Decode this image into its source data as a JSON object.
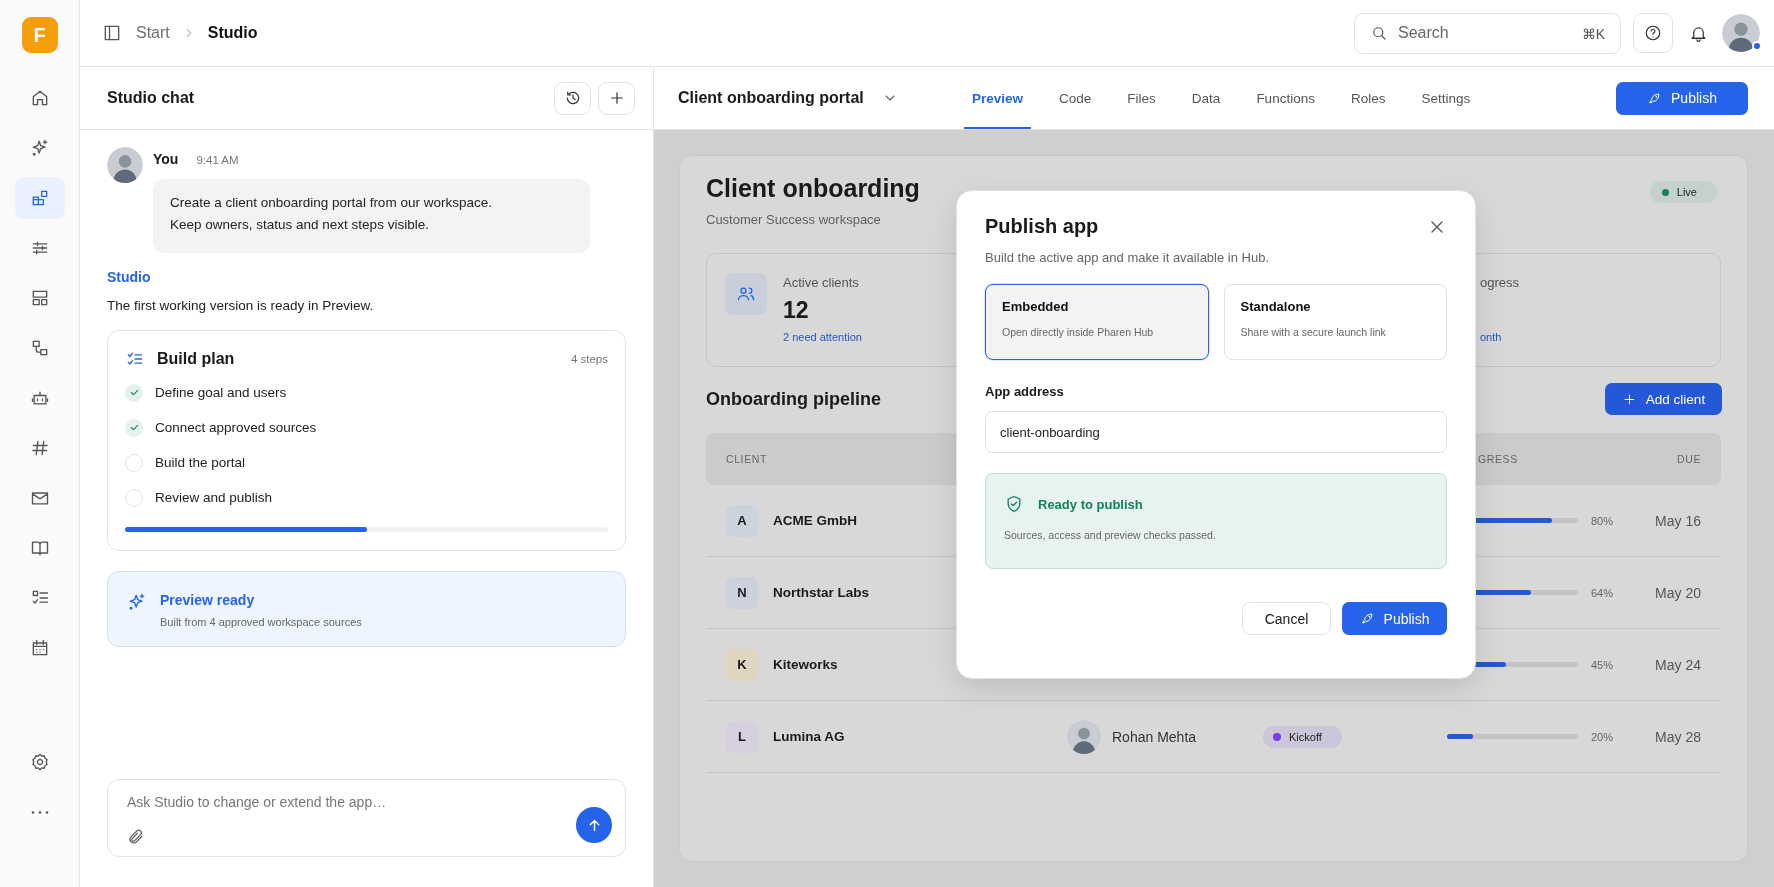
{
  "rail": {
    "logo": "F",
    "items": [
      {
        "selected": false
      },
      {
        "selected": false
      },
      {
        "selected": true
      },
      {
        "selected": false
      },
      {
        "selected": false
      },
      {
        "selected": false
      },
      {
        "selected": false
      },
      {
        "selected": false
      },
      {
        "selected": false
      },
      {
        "selected": false
      },
      {
        "selected": false
      },
      {
        "selected": false
      }
    ]
  },
  "topbar": {
    "breadcrumb": [
      {
        "label": "Start",
        "current": false
      },
      {
        "label": "Studio",
        "current": true
      }
    ],
    "search": {
      "placeholder": "Search",
      "shortcut": "⌘K"
    },
    "user": {
      "online": true
    }
  },
  "chat": {
    "title": "Studio chat",
    "user_message": {
      "author": "You",
      "time": "9:41 AM",
      "lines": [
        "Create a client onboarding portal from our workspace.",
        "Keep owners, status and next steps visible."
      ]
    },
    "reply": {
      "author": "Studio",
      "text": "The first working version is ready in Preview."
    },
    "plan": {
      "title": "Build plan",
      "count": "4 steps",
      "level": 0.5,
      "steps": [
        {
          "label": "Define goal and users",
          "done": true
        },
        {
          "label": "Connect approved sources",
          "done": true
        },
        {
          "label": "Build the portal",
          "done": false
        },
        {
          "label": "Review and publish",
          "done": false
        }
      ]
    },
    "notice": {
      "title": "Preview ready",
      "text": "Built from 4 approved workspace sources"
    },
    "composer": {
      "placeholder": "Ask Studio to change or extend the app…"
    }
  },
  "app": {
    "title": "Client onboarding portal",
    "tabs": [
      {
        "label": "Preview",
        "selected": true
      },
      {
        "label": "Code",
        "selected": false
      },
      {
        "label": "Files",
        "selected": false
      },
      {
        "label": "Data",
        "selected": false
      },
      {
        "label": "Functions",
        "selected": false
      },
      {
        "label": "Roles",
        "selected": false
      },
      {
        "label": "Settings",
        "selected": false
      }
    ],
    "publish_button": "Publish"
  },
  "preview": {
    "title": "Client onboarding",
    "subtitle": "Customer Success workspace",
    "status": "Live",
    "kpis": [
      {
        "label": "Active clients",
        "value": "12",
        "note": "2 need attention"
      },
      {
        "label": "ogress",
        "note": "onth"
      }
    ],
    "section_title": "Onboarding pipeline",
    "add_button": "Add client",
    "table": {
      "header": {
        "column_1": "CLIENT",
        "column_4": "GRESS",
        "column_5": "DUE"
      },
      "rows": [
        {
          "initial": "A",
          "color": "#cdd3dc",
          "name": "ACME GmbH",
          "level": 0.8,
          "percent": "80%",
          "due": "May 16"
        },
        {
          "initial": "N",
          "color": "#ccd1dd",
          "name": "Northstar Labs",
          "level": 0.64,
          "percent": "64%",
          "due": "May 20"
        },
        {
          "initial": "K",
          "color": "#e0d6c0",
          "name": "Kiteworks",
          "level": 0.45,
          "percent": "45%",
          "due": "May 24"
        },
        {
          "initial": "L",
          "color": "#d5cfdf",
          "name": "Lumina AG",
          "owner": "Rohan Mehta",
          "status": {
            "label": "Kickoff",
            "color": "#7c3aed"
          },
          "level": 0.2,
          "percent": "20%",
          "due": "May 28"
        }
      ]
    }
  },
  "modal": {
    "title": "Publish app",
    "subtitle": "Build the active app and make it available in Hub.",
    "options": [
      {
        "title": "Embedded",
        "text": "Open directly inside Pharen Hub",
        "selected": true
      },
      {
        "title": "Standalone",
        "text": "Share with a secure launch link",
        "selected": false
      }
    ],
    "address_label": "App address",
    "address_value": "client-onboarding",
    "check": {
      "title": "Ready to publish",
      "text": "Sources, access and preview checks passed."
    },
    "cancel_button": "Cancel",
    "confirm_button": "Publish"
  }
}
